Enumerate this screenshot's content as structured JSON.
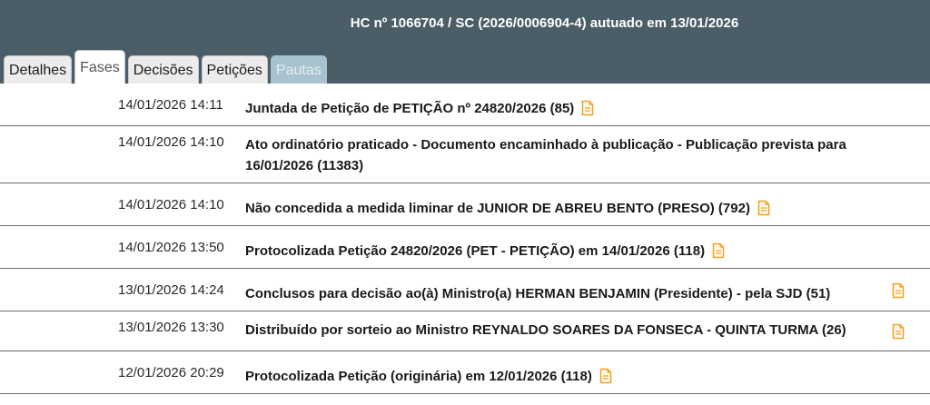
{
  "header": {
    "title": "HC nº 1066704 / SC (2026/0006904-4) autuado em 13/01/2026"
  },
  "tabs": [
    {
      "label": "Detalhes"
    },
    {
      "label": "Fases"
    },
    {
      "label": "Decisões"
    },
    {
      "label": "Petições"
    },
    {
      "label": "Pautas"
    }
  ],
  "phases": [
    {
      "datetime": "14/01/2026 14:11",
      "text": "Juntada de Petição de PETIÇÃO nº 24820/2026 (85)",
      "icon": "document-icon"
    },
    {
      "datetime": "14/01/2026 14:10",
      "text": "Ato ordinatório praticado - Documento encaminhado à publicação - Publicação prevista para 16/01/2026 (11383)"
    },
    {
      "datetime": "14/01/2026 14:10",
      "text": "Não concedida a medida liminar de JUNIOR DE ABREU BENTO (PRESO) (792)",
      "icon": "document-icon"
    },
    {
      "datetime": "14/01/2026 13:50",
      "text": "Protocolizada Petição 24820/2026 (PET - PETIÇÃO) em 14/01/2026 (118)",
      "icon": "document-icon"
    },
    {
      "datetime": "13/01/2026 14:24",
      "text": "Conclusos para decisão ao(à) Ministro(a) HERMAN BENJAMIN (Presidente) - pela SJD (51)",
      "icon": "document-icon"
    },
    {
      "datetime": "13/01/2026 13:30",
      "text": "Distribuído por sorteio ao Ministro REYNALDO SOARES DA FONSECA - QUINTA TURMA (26)",
      "icon": "document-icon"
    },
    {
      "datetime": "12/01/2026 20:29",
      "text": "Protocolizada Petição (originária) em 12/01/2026 (118)",
      "icon": "document-icon"
    }
  ],
  "colors": {
    "header_bg": "#4b5d67",
    "icon_color": "#f0a020",
    "disabled_tab": "#a8c3cf"
  }
}
